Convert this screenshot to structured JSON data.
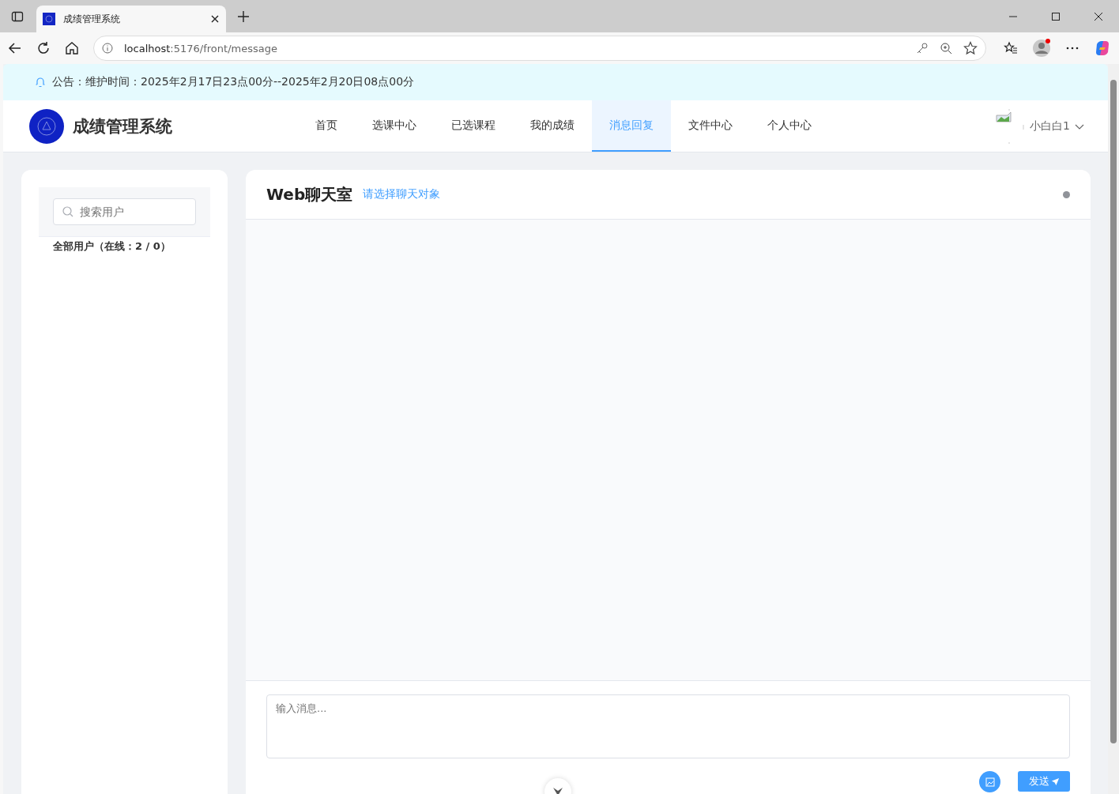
{
  "browser": {
    "tab_title": "成绩管理系统",
    "url_host": "localhost",
    "url_path": ":5176/front/message"
  },
  "notice": {
    "text": "公告：维护时间：2025年2月17日23点00分--2025年2月20日08点00分"
  },
  "header": {
    "title": "成绩管理系统",
    "nav": [
      {
        "label": "首页",
        "selected": false
      },
      {
        "label": "选课中心",
        "selected": false
      },
      {
        "label": "已选课程",
        "selected": false
      },
      {
        "label": "我的成绩",
        "selected": false
      },
      {
        "label": "消息回复",
        "selected": true
      },
      {
        "label": "文件中心",
        "selected": false
      },
      {
        "label": "个人中心",
        "selected": false
      }
    ],
    "user": "小白白1"
  },
  "sidebar": {
    "search": {
      "placeholder": "搜索用户"
    },
    "users_label": "全部用户（在线：2 / 0）"
  },
  "chat": {
    "title": "Web聊天室",
    "subtitle": "请选择聊天对象",
    "connected": false,
    "input": {
      "placeholder": "输入消息..."
    },
    "send_button": "发送"
  }
}
